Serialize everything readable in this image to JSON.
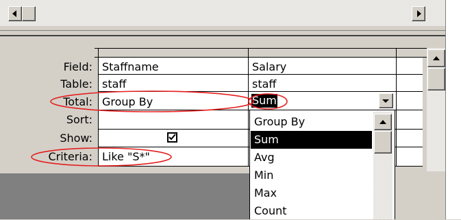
{
  "grid": {
    "row_labels": [
      "Field:",
      "Table:",
      "Total:",
      "Sort:",
      "Show:",
      "Criteria:"
    ],
    "columns": [
      {
        "field": "Staffname",
        "table": "staff",
        "total": "Group By",
        "sort": "",
        "show": true,
        "criteria": "Like \"S*\""
      },
      {
        "field": "Salary",
        "table": "staff",
        "total": "Sum",
        "sort": "",
        "show": false,
        "criteria": ""
      }
    ]
  },
  "dropdown": {
    "options": [
      "Group By",
      "Sum",
      "Avg",
      "Min",
      "Max",
      "Count"
    ],
    "selected": "Sum"
  },
  "icons": {
    "h_scroll_left": "arrow-left-icon",
    "h_scroll_right": "arrow-right-icon",
    "v_scroll_up": "arrow-up-icon",
    "dropdown_toggle": "chevron-down-icon",
    "show_checkbox": "checkmark-icon"
  },
  "colors": {
    "highlight": "#000000",
    "annotation": "#e41e1e",
    "window_face": "#d4d0c8",
    "empty_area": "#808080"
  }
}
